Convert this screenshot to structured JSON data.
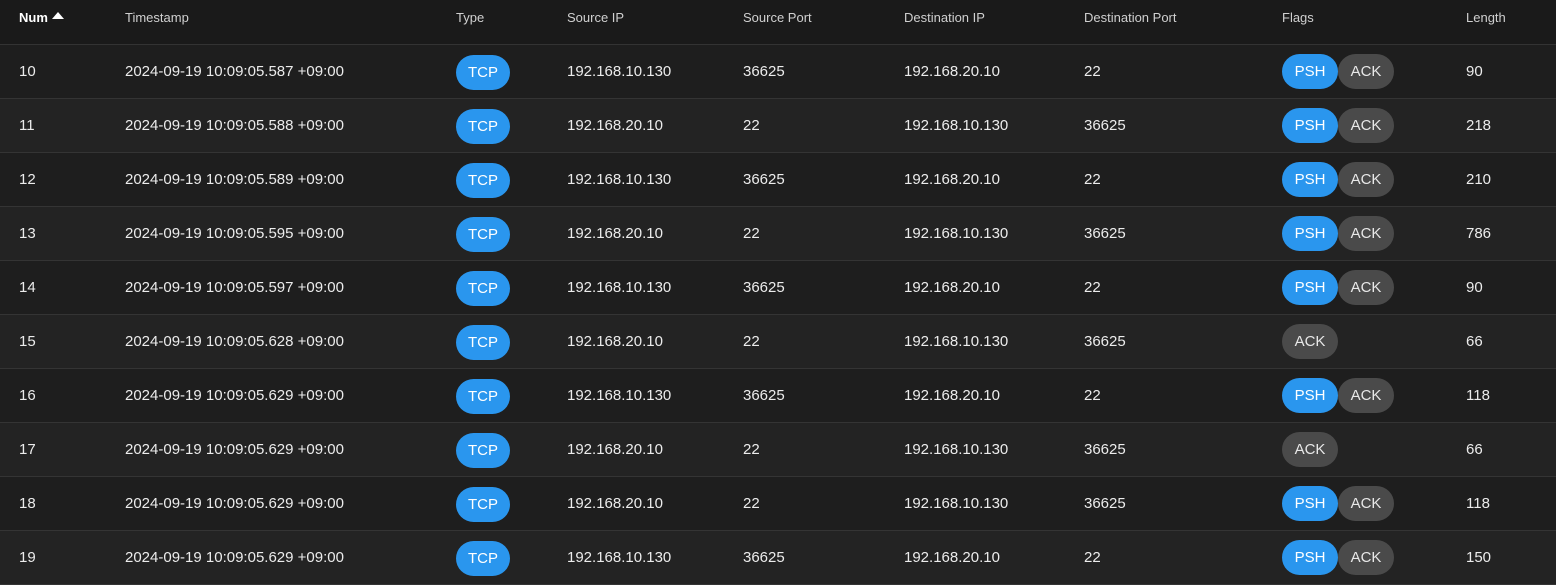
{
  "table": {
    "columns": [
      {
        "key": "num",
        "label": "Num",
        "sorted": "asc"
      },
      {
        "key": "timestamp",
        "label": "Timestamp"
      },
      {
        "key": "type",
        "label": "Type"
      },
      {
        "key": "src_ip",
        "label": "Source IP"
      },
      {
        "key": "src_port",
        "label": "Source Port"
      },
      {
        "key": "dst_ip",
        "label": "Destination IP"
      },
      {
        "key": "dst_port",
        "label": "Destination Port"
      },
      {
        "key": "flags",
        "label": "Flags"
      },
      {
        "key": "length",
        "label": "Length"
      }
    ],
    "rows": [
      {
        "num": "10",
        "timestamp": "2024-09-19 10:09:05.587 +09:00",
        "type": "TCP",
        "src_ip": "192.168.10.130",
        "src_port": "36625",
        "dst_ip": "192.168.20.10",
        "dst_port": "22",
        "flags": [
          "PSH",
          "ACK"
        ],
        "length": "90"
      },
      {
        "num": "11",
        "timestamp": "2024-09-19 10:09:05.588 +09:00",
        "type": "TCP",
        "src_ip": "192.168.20.10",
        "src_port": "22",
        "dst_ip": "192.168.10.130",
        "dst_port": "36625",
        "flags": [
          "PSH",
          "ACK"
        ],
        "length": "218"
      },
      {
        "num": "12",
        "timestamp": "2024-09-19 10:09:05.589 +09:00",
        "type": "TCP",
        "src_ip": "192.168.10.130",
        "src_port": "36625",
        "dst_ip": "192.168.20.10",
        "dst_port": "22",
        "flags": [
          "PSH",
          "ACK"
        ],
        "length": "210"
      },
      {
        "num": "13",
        "timestamp": "2024-09-19 10:09:05.595 +09:00",
        "type": "TCP",
        "src_ip": "192.168.20.10",
        "src_port": "22",
        "dst_ip": "192.168.10.130",
        "dst_port": "36625",
        "flags": [
          "PSH",
          "ACK"
        ],
        "length": "786"
      },
      {
        "num": "14",
        "timestamp": "2024-09-19 10:09:05.597 +09:00",
        "type": "TCP",
        "src_ip": "192.168.10.130",
        "src_port": "36625",
        "dst_ip": "192.168.20.10",
        "dst_port": "22",
        "flags": [
          "PSH",
          "ACK"
        ],
        "length": "90"
      },
      {
        "num": "15",
        "timestamp": "2024-09-19 10:09:05.628 +09:00",
        "type": "TCP",
        "src_ip": "192.168.20.10",
        "src_port": "22",
        "dst_ip": "192.168.10.130",
        "dst_port": "36625",
        "flags": [
          "ACK"
        ],
        "length": "66"
      },
      {
        "num": "16",
        "timestamp": "2024-09-19 10:09:05.629 +09:00",
        "type": "TCP",
        "src_ip": "192.168.10.130",
        "src_port": "36625",
        "dst_ip": "192.168.20.10",
        "dst_port": "22",
        "flags": [
          "PSH",
          "ACK"
        ],
        "length": "118"
      },
      {
        "num": "17",
        "timestamp": "2024-09-19 10:09:05.629 +09:00",
        "type": "TCP",
        "src_ip": "192.168.20.10",
        "src_port": "22",
        "dst_ip": "192.168.10.130",
        "dst_port": "36625",
        "flags": [
          "ACK"
        ],
        "length": "66"
      },
      {
        "num": "18",
        "timestamp": "2024-09-19 10:09:05.629 +09:00",
        "type": "TCP",
        "src_ip": "192.168.20.10",
        "src_port": "22",
        "dst_ip": "192.168.10.130",
        "dst_port": "36625",
        "flags": [
          "PSH",
          "ACK"
        ],
        "length": "118"
      },
      {
        "num": "19",
        "timestamp": "2024-09-19 10:09:05.629 +09:00",
        "type": "TCP",
        "src_ip": "192.168.10.130",
        "src_port": "36625",
        "dst_ip": "192.168.20.10",
        "dst_port": "22",
        "flags": [
          "PSH",
          "ACK"
        ],
        "length": "150"
      }
    ]
  },
  "icons": {
    "sort": "sort-ascending-icon"
  },
  "colors": {
    "accent": "#2a96ee",
    "ack_pill": "#4a4a4a",
    "background": "#1e1e1e"
  }
}
